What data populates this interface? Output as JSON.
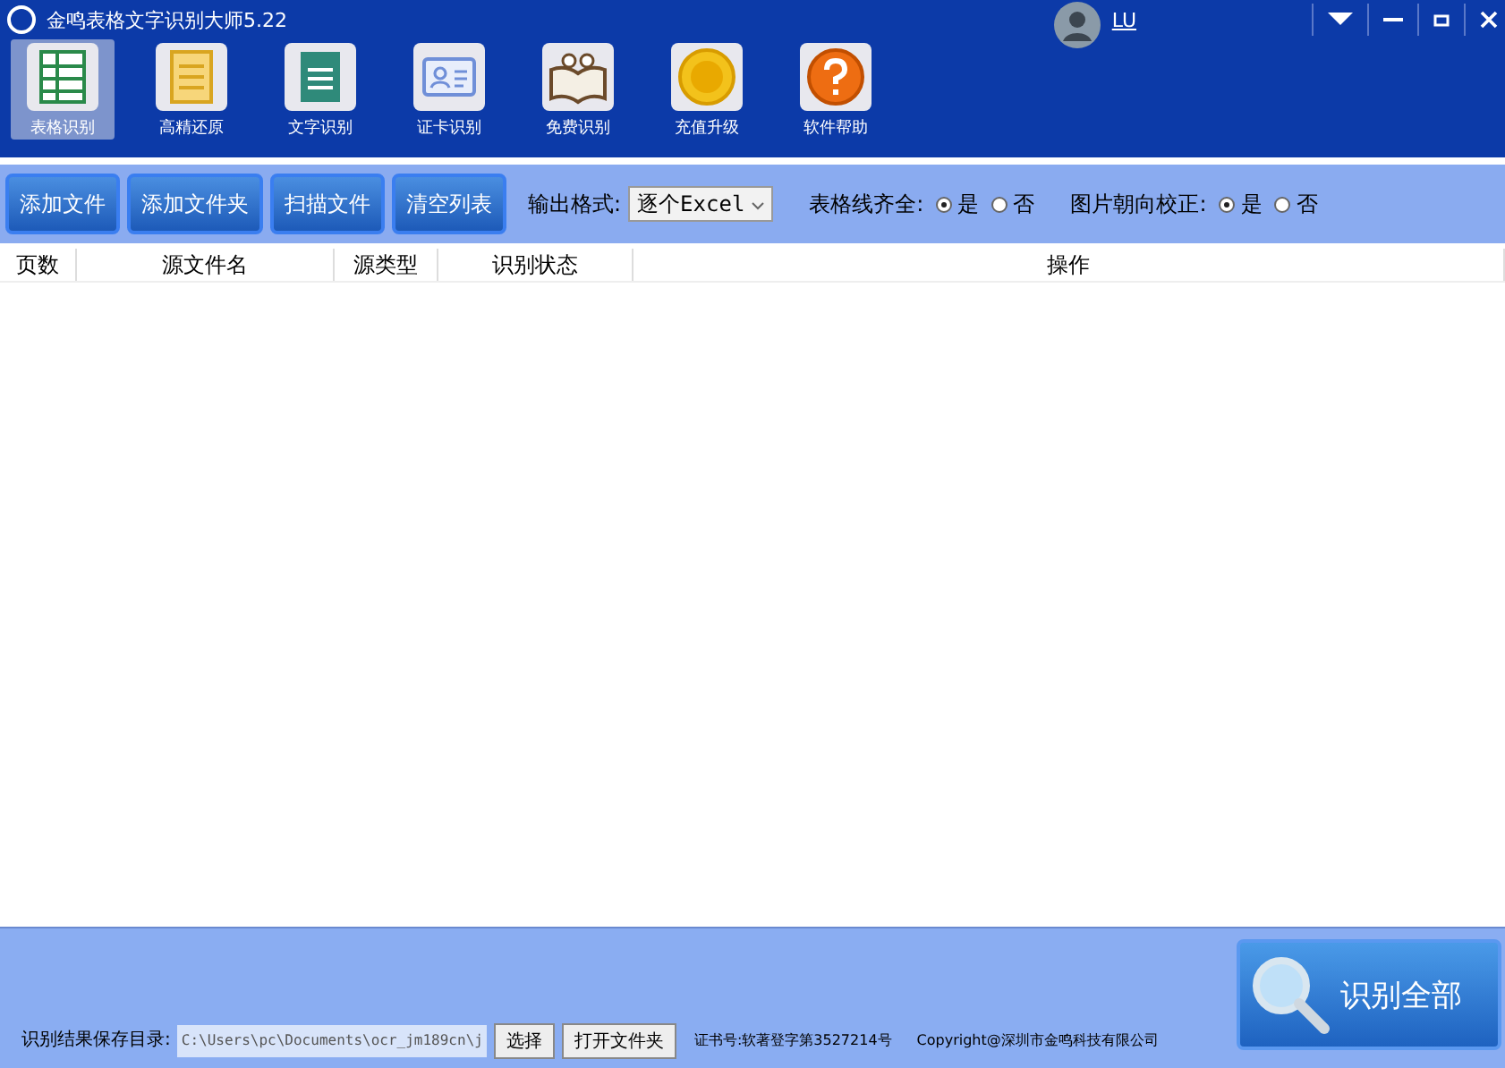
{
  "window": {
    "title": "金鸣表格文字识别大师5.22",
    "user": "LU"
  },
  "toolbar": [
    {
      "label": "表格识别",
      "selected": true
    },
    {
      "label": "高精还原",
      "selected": false
    },
    {
      "label": "文字识别",
      "selected": false
    },
    {
      "label": "证卡识别",
      "selected": false
    },
    {
      "label": "免费识别",
      "selected": false
    },
    {
      "label": "充值升级",
      "selected": false
    },
    {
      "label": "软件帮助",
      "selected": false
    }
  ],
  "actions": [
    "添加文件",
    "添加文件夹",
    "扫描文件",
    "清空列表"
  ],
  "output_format": {
    "label": "输出格式:",
    "value": "逐个Excel"
  },
  "options": [
    {
      "label": "表格线齐全:",
      "choices": [
        {
          "label": "是",
          "selected": true
        },
        {
          "label": "否",
          "selected": false
        }
      ]
    },
    {
      "label": "图片朝向校正:",
      "choices": [
        {
          "label": "是",
          "selected": true
        },
        {
          "label": "否",
          "selected": false
        }
      ]
    }
  ],
  "table": {
    "columns": [
      "页数",
      "源文件名",
      "源类型",
      "识别状态",
      "操作"
    ]
  },
  "footer": {
    "save_label": "识别结果保存目录:",
    "save_path": "C:\\Users\\pc\\Documents\\ocr_jm189cn\\j",
    "buttons": [
      "选择",
      "打开文件夹"
    ],
    "certificate": "证书号:软著登字第3527214号",
    "copyright": "Copyright@深圳市金鸣科技有限公司",
    "main_button": "识别全部"
  }
}
